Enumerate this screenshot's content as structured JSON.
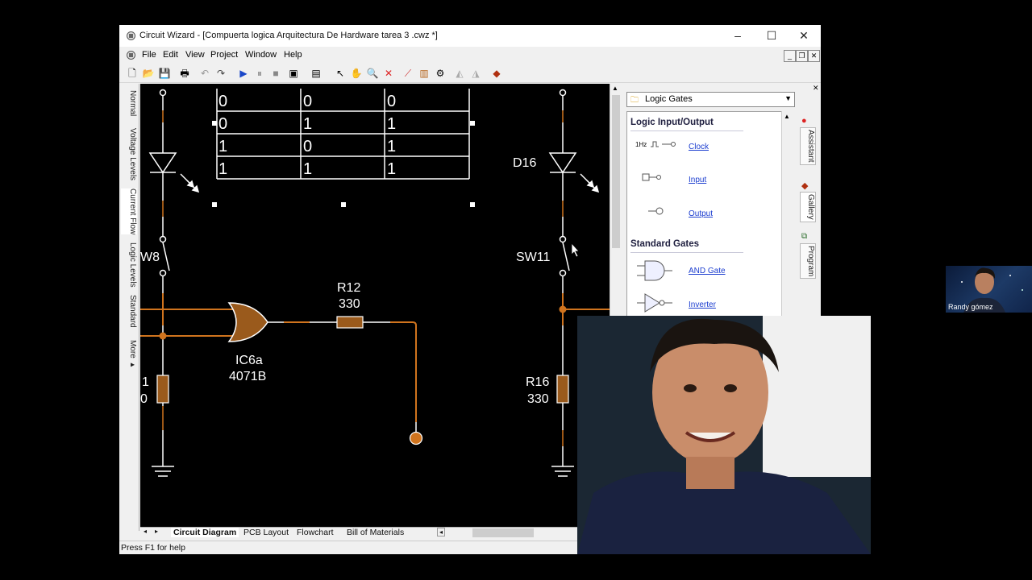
{
  "window": {
    "title": "Circuit Wizard - [Compuerta logica Arquitectura De Hardware tarea 3  .cwz *]",
    "controls": [
      "–",
      "☐",
      "✕"
    ]
  },
  "menu": [
    "File",
    "Edit",
    "View",
    "Project",
    "Window",
    "Help"
  ],
  "left_tabs": [
    "Normal",
    "Voltage Levels",
    "Current Flow",
    "Logic Levels",
    "Standard",
    "More ▸"
  ],
  "truth_table": [
    [
      "0",
      "0",
      "0"
    ],
    [
      "0",
      "1",
      "1"
    ],
    [
      "1",
      "0",
      "1"
    ],
    [
      "1",
      "1",
      "1"
    ]
  ],
  "circuit": {
    "gate_name": "IC6a",
    "gate_part": "4071B",
    "r12_name": "R12",
    "r12_value": "330",
    "left_switch": "W8",
    "left_res_name": "1",
    "left_res_value": "0",
    "right_led": "D16",
    "right_switch": "SW11",
    "r16_name": "R16",
    "r16_value": "330"
  },
  "gallery": {
    "selector": "Logic Gates",
    "section1": "Logic Input/Output",
    "clock_freq": "1Hz",
    "items1": [
      "Clock",
      "Input",
      "Output"
    ],
    "section2": "Standard Gates",
    "items2": [
      "AND Gate",
      "Inverter"
    ]
  },
  "right_tabs": [
    "Assistant",
    "Gallery",
    "Program"
  ],
  "bottom_tabs": [
    "Circuit Diagram",
    "PCB Layout",
    "Flowchart",
    "Bill of Materials"
  ],
  "status": "Press F1 for help",
  "webcam_name": "Randy gómez",
  "colors": {
    "wire": "#d0741e",
    "component": "#9a5a1c",
    "canvas": "#000000",
    "link": "#1a3ccf"
  }
}
